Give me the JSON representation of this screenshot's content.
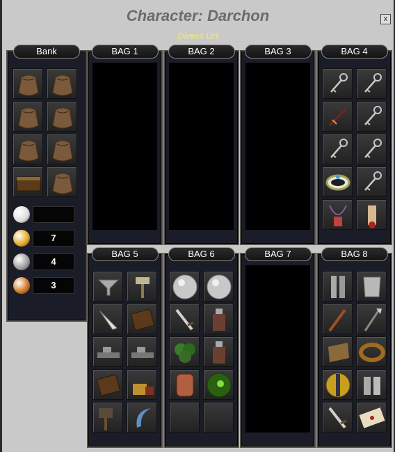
{
  "window": {
    "title": "Character: Darchon",
    "subtitle": "Direct Url",
    "close": "x"
  },
  "bank": {
    "label": "Bank",
    "slots": [
      "sack-icon",
      "sack-icon",
      "sack-icon",
      "sack-icon",
      "sack-icon",
      "sack-icon",
      "chest-icon",
      "sack-icon"
    ],
    "currency": [
      {
        "name": "platinum-coin-icon",
        "value": "",
        "color": "#dcdcdc"
      },
      {
        "name": "gold-coin-icon",
        "value": "7",
        "color": "#e0a820"
      },
      {
        "name": "silver-coin-icon",
        "value": "4",
        "color": "#9a9a9a"
      },
      {
        "name": "copper-coin-icon",
        "value": "3",
        "color": "#d0701a"
      }
    ]
  },
  "bags": [
    {
      "label": "BAG 1",
      "empty": true
    },
    {
      "label": "BAG 2",
      "empty": true
    },
    {
      "label": "BAG 3",
      "empty": true
    },
    {
      "label": "BAG 4",
      "items": [
        "key-icon",
        "key-icon",
        "dagger-icon",
        "key-icon",
        "key-icon",
        "key-icon",
        "bracelet-icon",
        "key-icon",
        "amulet-icon",
        "scroll-icon"
      ]
    },
    {
      "label": "BAG 5",
      "items": [
        "funnel-icon",
        "hammer-icon",
        "tooth-icon",
        "book-icon",
        "plane-tool-icon",
        "plane-tool-icon",
        "book-icon",
        "lock-icon",
        "mallet-icon",
        "sickle-icon"
      ]
    },
    {
      "label": "BAG 6",
      "items": [
        "orb-icon",
        "orb-icon",
        "sword-icon",
        "flask-icon",
        "leaves-icon",
        "flask-icon",
        "drum-icon",
        "green-orb-icon",
        "",
        ""
      ]
    },
    {
      "label": "BAG 7",
      "empty": true
    },
    {
      "label": "BAG 8",
      "items": [
        "greaves-icon",
        "breastplate-icon",
        "staff-icon",
        "spear-icon",
        "leather-icon",
        "belt-icon",
        "shield-icon",
        "gauntlets-icon",
        "sword-icon",
        "letter-icon"
      ]
    }
  ]
}
